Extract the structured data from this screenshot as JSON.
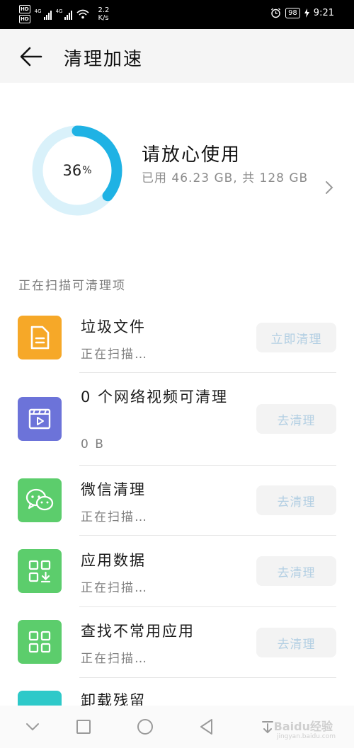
{
  "status_bar": {
    "hd1": "HD",
    "hd2": "HD",
    "net1": "4G",
    "net2": "4G",
    "speed_value": "2.2",
    "speed_unit": "K/s",
    "battery": "98",
    "time": "9:21"
  },
  "header": {
    "title": "清理加速"
  },
  "storage": {
    "percent": "36",
    "percent_unit": "%",
    "used_fraction": 0.36,
    "status": "请放心使用",
    "usage_text": "已用 46.23 GB, 共 128 GB"
  },
  "scan": {
    "label": "正在扫描可清理项",
    "items": [
      {
        "name": "垃圾文件",
        "sub": "正在扫描…",
        "button": "立即清理",
        "color": "#f6a828"
      },
      {
        "name": "0 个网络视频可清理",
        "sub": "0 B",
        "button": "去清理",
        "color": "#6c73d9"
      },
      {
        "name": "微信清理",
        "sub": "正在扫描…",
        "button": "去清理",
        "color": "#5ccd6c"
      },
      {
        "name": "应用数据",
        "sub": "正在扫描…",
        "button": "去清理",
        "color": "#5ccd6c"
      },
      {
        "name": "查找不常用应用",
        "sub": "正在扫描…",
        "button": "去清理",
        "color": "#5ccd6c"
      },
      {
        "name": "卸载残留",
        "color": "#2ec9c9"
      }
    ]
  },
  "colors": {
    "accent": "#1fb2e4",
    "ring_track": "#d9f1fa"
  },
  "watermark": {
    "brand": "Baidu经验",
    "url": "jingyan.baidu.com"
  }
}
